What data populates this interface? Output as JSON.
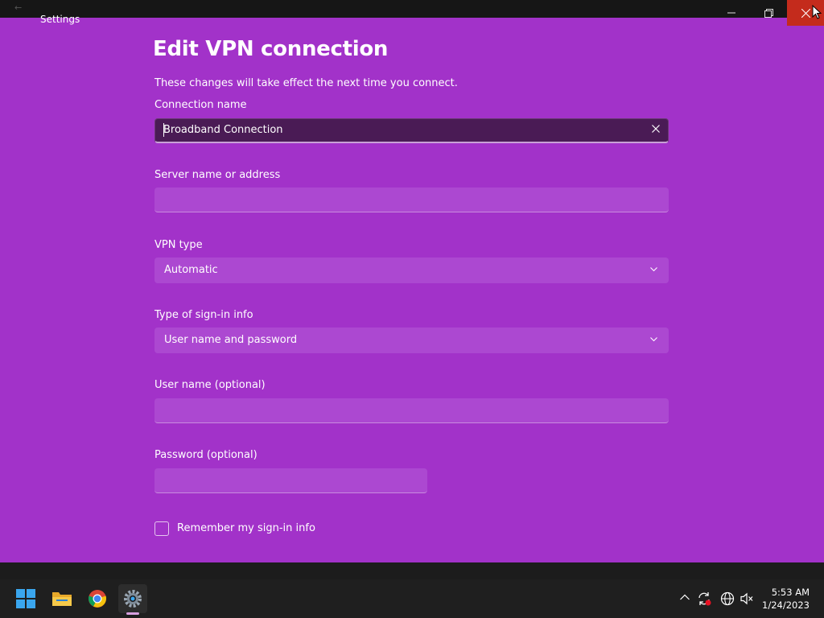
{
  "window": {
    "app_title": "Settings",
    "back_glyph": "←",
    "controls": [
      "minimize-icon",
      "maximize-icon",
      "close-icon"
    ]
  },
  "dialog": {
    "title": "Edit VPN connection",
    "subtitle": "These changes will take effect the next time you connect.",
    "connection_name": {
      "label": "Connection name",
      "value": "Broadband Connection"
    },
    "server": {
      "label": "Server name or address",
      "value": ""
    },
    "vpn_type": {
      "label": "VPN type",
      "value": "Automatic"
    },
    "signin_type": {
      "label": "Type of sign-in info",
      "value": "User name and password"
    },
    "username": {
      "label": "User name (optional)",
      "value": ""
    },
    "password": {
      "label": "Password (optional)",
      "value": ""
    },
    "remember": {
      "label": "Remember my sign-in info",
      "checked": false
    }
  },
  "taskbar": {
    "apps": [
      "windows-start-icon",
      "file-explorer-icon",
      "chrome-icon",
      "settings-gear-icon"
    ],
    "tray_icons": [
      "chevron-up-icon",
      "sync-icon",
      "network-globe-icon",
      "speaker-muted-icon"
    ],
    "time": "5:53 AM",
    "date": "1/24/2023"
  },
  "colors": {
    "accent": "#a232c9",
    "field": "#ac48d1",
    "close": "#c42b1c"
  }
}
